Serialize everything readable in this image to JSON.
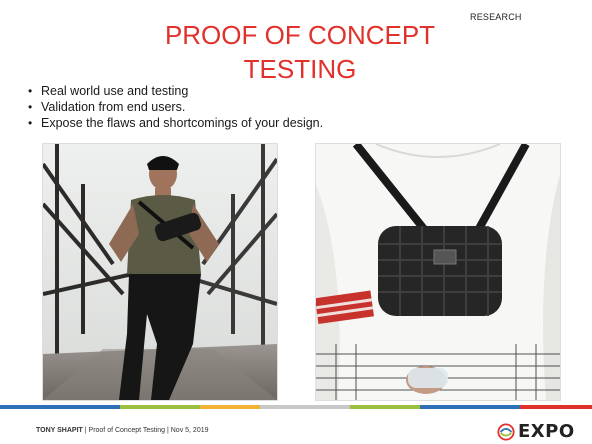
{
  "slide": {
    "tag": "RESEARCH",
    "title": "PROOF OF CONCEPT TESTING",
    "bullets": [
      "Real world use and testing",
      "Validation from end users.",
      "Expose the flaws and shortcomings of your design."
    ]
  },
  "images": {
    "left": {
      "icon": "photo-man-running-with-sling-bag"
    },
    "right": {
      "icon": "photo-man-wearing-chest-sling-bag"
    }
  },
  "footer": {
    "presenter": "TONY SHAPIT",
    "details": " | Proof of Concept Testing | Nov 5, 2019",
    "logo_text": "EXPO",
    "bar_colors": [
      "#2f6fb3",
      "#9bbf3f",
      "#f2b233",
      "#c8c8c8",
      "#9bbf3f",
      "#2f6fb3",
      "#e0312b"
    ]
  },
  "colors": {
    "title": "#e0312b"
  }
}
